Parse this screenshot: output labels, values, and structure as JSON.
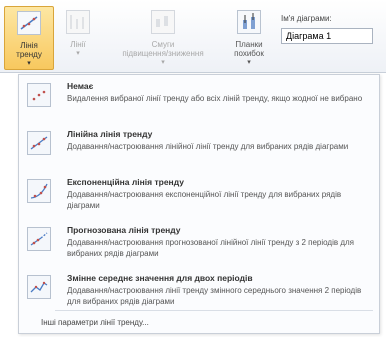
{
  "ribbon": {
    "buttons": [
      {
        "label_line1": "Лінія",
        "label_line2": "тренду",
        "icon": "trendline-icon",
        "state": "active"
      },
      {
        "label_line1": "Лінії",
        "label_line2": "",
        "icon": "lines-icon",
        "state": "disabled"
      },
      {
        "label_line1": "Смуги",
        "label_line2": "підвищення/зниження",
        "icon": "updown-bars-icon",
        "state": "disabled"
      },
      {
        "label_line1": "Планки",
        "label_line2": "похибок",
        "icon": "error-bars-icon",
        "state": "normal"
      }
    ],
    "chart_name_label": "Ім'я діаграми:",
    "chart_name_value": "Діаграма 1"
  },
  "menu": {
    "items": [
      {
        "title": "Немає",
        "desc": "Видалення вибраної лінії тренду або всіх ліній тренду, якщо жодної не вибрано",
        "icon": "no-trendline-icon"
      },
      {
        "title": "Лінійна лінія тренду",
        "desc": "Додавання/настроювання лінійної лінії тренду для вибраних рядів діаграми",
        "icon": "linear-trendline-icon"
      },
      {
        "title": "Експоненційна лінія тренду",
        "desc": "Додавання/настроювання експоненційної лінії тренду для вибраних рядів діаграми",
        "icon": "exponential-trendline-icon"
      },
      {
        "title": "Прогнозована лінія тренду",
        "desc": "Додавання/настроювання прогнозованої лінійної лінії тренду з 2 періодів для вибраних рядів діаграми",
        "icon": "forecast-trendline-icon"
      },
      {
        "title": "Змінне середнє значення для двох періодів",
        "desc": "Додавання/настроювання лінії тренду змінного середнього значення 2 періодів для вибраних рядів діаграми",
        "icon": "moving-average-icon"
      }
    ],
    "more_label": "Інші параметри лінії тренду..."
  },
  "colors": {
    "active_bg": "#f8c85e",
    "line_blue": "#4a7bc4",
    "dot": "#c0504d"
  }
}
